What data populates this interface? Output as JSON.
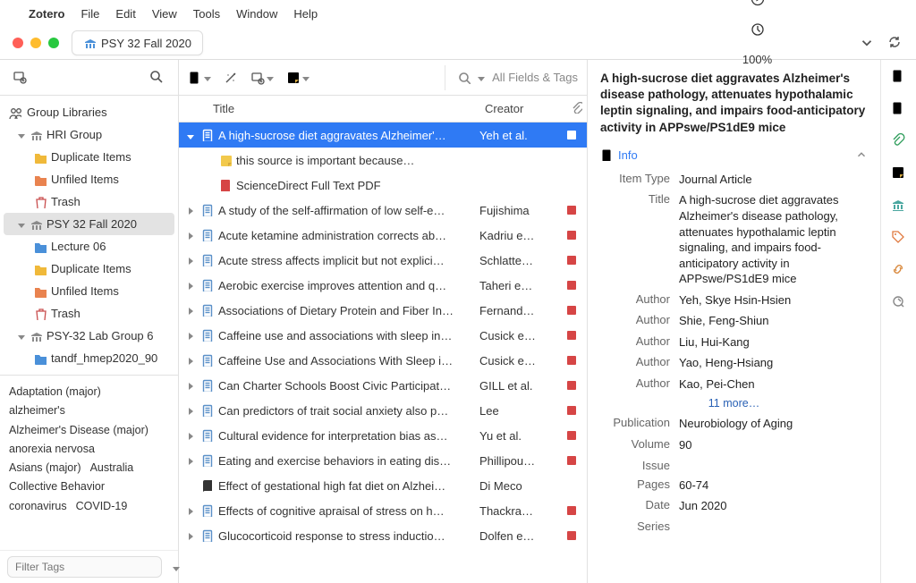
{
  "menubar": {
    "app": "Zotero",
    "items": [
      "File",
      "Edit",
      "View",
      "Tools",
      "Window",
      "Help"
    ],
    "battery_pct": "100%"
  },
  "window": {
    "tab_label": "PSY 32 Fall 2020"
  },
  "sidebar": {
    "group_header": "Group Libraries",
    "groups": [
      {
        "name": "HRI Group",
        "children": [
          {
            "label": "Duplicate Items",
            "icon": "dup"
          },
          {
            "label": "Unfiled Items",
            "icon": "unfiled"
          },
          {
            "label": "Trash",
            "icon": "trash"
          }
        ]
      },
      {
        "name": "PSY 32 Fall 2020",
        "selected": true,
        "children": [
          {
            "label": "Lecture 06",
            "icon": "folder-blue"
          },
          {
            "label": "Duplicate Items",
            "icon": "dup"
          },
          {
            "label": "Unfiled Items",
            "icon": "unfiled"
          },
          {
            "label": "Trash",
            "icon": "trash"
          }
        ]
      },
      {
        "name": "PSY-32 Lab Group 6",
        "children": [
          {
            "label": "tandf_hmep2020_90",
            "icon": "folder-blue"
          }
        ]
      }
    ]
  },
  "tags": [
    "Adaptation (major)",
    "alzheimer's",
    "Alzheimer's Disease (major)",
    "anorexia nervosa",
    "Asians (major)",
    "Australia",
    "Collective Behavior",
    "coronavirus",
    "COVID-19"
  ],
  "tag_filter_placeholder": "Filter Tags",
  "search": {
    "placeholder": "All Fields & Tags"
  },
  "columns": {
    "title": "Title",
    "creator": "Creator"
  },
  "rows": [
    {
      "expand": "down",
      "icon": "page",
      "title": "A high-sucrose diet aggravates Alzheimer'…",
      "creator": "Yeh et al.",
      "pdf": true,
      "selected": true
    },
    {
      "child": true,
      "icon": "note",
      "title": "this source is important because…",
      "creator": "",
      "pdf": false
    },
    {
      "child": true,
      "icon": "pdf",
      "title": "ScienceDirect Full Text PDF",
      "creator": "",
      "pdf": false
    },
    {
      "expand": "right",
      "icon": "page",
      "title": "A study of the self-affirmation of low self-e…",
      "creator": "Fujishima",
      "pdf": true
    },
    {
      "expand": "right",
      "icon": "page",
      "title": "Acute ketamine administration corrects ab…",
      "creator": "Kadriu e…",
      "pdf": true
    },
    {
      "expand": "right",
      "icon": "page",
      "title": "Acute stress affects implicit but not explici…",
      "creator": "Schlatte…",
      "pdf": true
    },
    {
      "expand": "right",
      "icon": "page",
      "title": "Aerobic exercise improves attention and q…",
      "creator": "Taheri e…",
      "pdf": true
    },
    {
      "expand": "right",
      "icon": "page",
      "title": "Associations of Dietary Protein and Fiber In…",
      "creator": "Fernand…",
      "pdf": true
    },
    {
      "expand": "right",
      "icon": "page",
      "title": "Caffeine use and associations with sleep in…",
      "creator": "Cusick e…",
      "pdf": true
    },
    {
      "expand": "right",
      "icon": "page",
      "title": "Caffeine Use and Associations With Sleep i…",
      "creator": "Cusick e…",
      "pdf": true
    },
    {
      "expand": "right",
      "icon": "page",
      "title": "Can Charter Schools Boost Civic Participat…",
      "creator": "GILL et al.",
      "pdf": true
    },
    {
      "expand": "right",
      "icon": "page",
      "title": "Can predictors of trait social anxiety also p…",
      "creator": "Lee",
      "pdf": true
    },
    {
      "expand": "right",
      "icon": "page",
      "title": "Cultural evidence for interpretation bias as…",
      "creator": "Yu et al.",
      "pdf": true
    },
    {
      "expand": "right",
      "icon": "page",
      "title": "Eating and exercise behaviors in eating dis…",
      "creator": "Phillipou…",
      "pdf": true
    },
    {
      "expand": "none",
      "icon": "book",
      "title": "Effect of gestational high fat diet on Alzhei…",
      "creator": "Di Meco",
      "pdf": false
    },
    {
      "expand": "right",
      "icon": "page",
      "title": "Effects of cognitive apraisal of stress on h…",
      "creator": "Thackra…",
      "pdf": true
    },
    {
      "expand": "right",
      "icon": "page",
      "title": "Glucocorticoid response to stress inductio…",
      "creator": "Dolfen e…",
      "pdf": true
    }
  ],
  "info": {
    "header_title": "A high-sucrose diet aggravates Alzheimer's disease pathology, attenuates hypothalamic leptin signaling, and impairs food-anticipatory activity in APPswe/PS1dE9 mice",
    "section": "Info",
    "fields": [
      {
        "label": "Item Type",
        "value": "Journal Article"
      },
      {
        "label": "Title",
        "value": "A high-sucrose diet aggravates Alzheimer's disease pathology, attenuates hypothalamic leptin signaling, and impairs food-anticipatory activity in APPswe/PS1dE9 mice"
      },
      {
        "label": "Author",
        "value": "Yeh, Skye Hsin-Hsien"
      },
      {
        "label": "Author",
        "value": "Shie, Feng-Shiun"
      },
      {
        "label": "Author",
        "value": "Liu, Hui-Kang"
      },
      {
        "label": "Author",
        "value": "Yao, Heng-Hsiang"
      },
      {
        "label": "Author",
        "value": "Kao, Pei-Chen"
      }
    ],
    "more_authors": "11 more…",
    "fields2": [
      {
        "label": "Publication",
        "value": "Neurobiology of Aging"
      },
      {
        "label": "Volume",
        "value": "90"
      },
      {
        "label": "Issue",
        "value": ""
      },
      {
        "label": "Pages",
        "value": "60-74"
      },
      {
        "label": "Date",
        "value": "Jun 2020"
      },
      {
        "label": "Series",
        "value": ""
      }
    ]
  }
}
